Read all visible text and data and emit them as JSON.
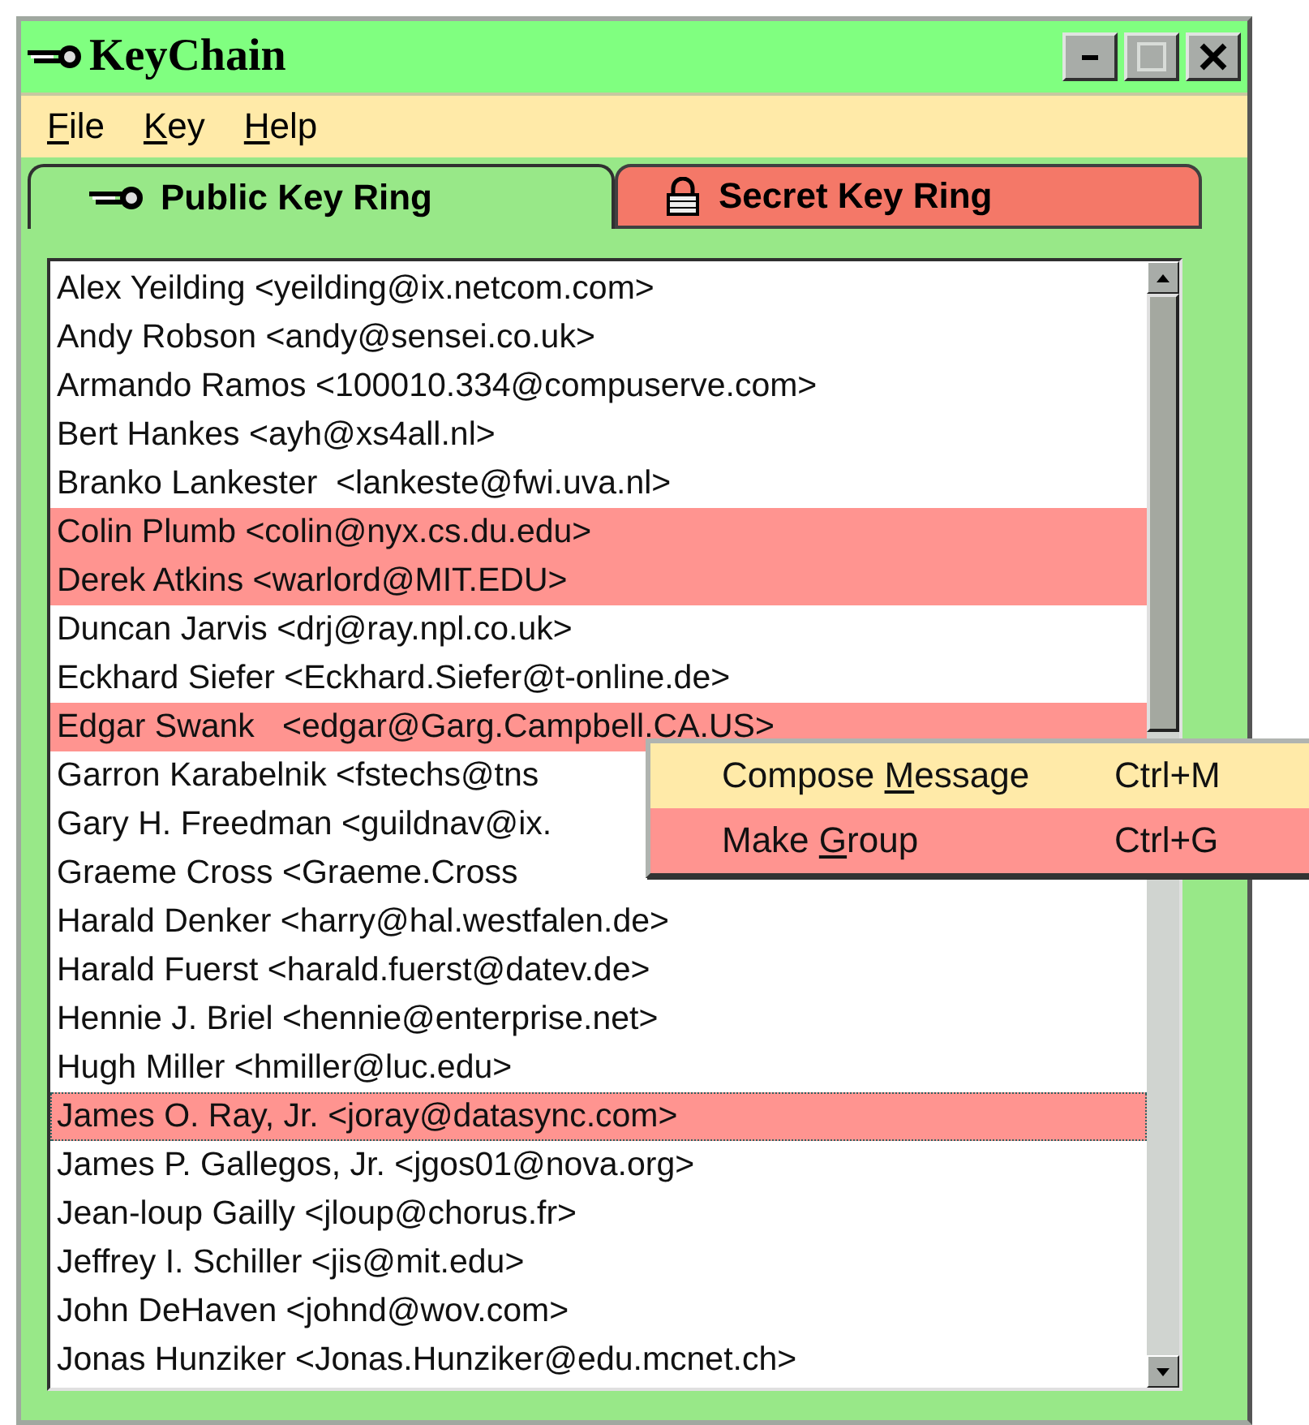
{
  "window": {
    "title": "KeyChain"
  },
  "menu_bar": [
    {
      "mnemonic": "F",
      "label_rest": "ile"
    },
    {
      "mnemonic": "K",
      "label_rest": "ey"
    },
    {
      "mnemonic": "H",
      "label_rest": "elp"
    }
  ],
  "tabs": [
    {
      "label": "Public Key Ring",
      "kind": "key",
      "selected": true,
      "color": "#98e888"
    },
    {
      "label": "Secret Key Ring",
      "kind": "lock",
      "selected": false,
      "color": "#f47868"
    }
  ],
  "keys": [
    {
      "text": "Alex Yeilding <yeilding@ix.netcom.com>",
      "selected": false,
      "focused": false
    },
    {
      "text": "Andy Robson <andy@sensei.co.uk>",
      "selected": false,
      "focused": false
    },
    {
      "text": "Armando Ramos <100010.334@compuserve.com>",
      "selected": false,
      "focused": false
    },
    {
      "text": "Bert Hankes <ayh@xs4all.nl>",
      "selected": false,
      "focused": false
    },
    {
      "text": "Branko Lankester  <lankeste@fwi.uva.nl>",
      "selected": false,
      "focused": false
    },
    {
      "text": "Colin Plumb <colin@nyx.cs.du.edu>",
      "selected": true,
      "focused": false
    },
    {
      "text": "Derek Atkins <warlord@MIT.EDU>",
      "selected": true,
      "focused": false
    },
    {
      "text": "Duncan Jarvis <drj@ray.npl.co.uk>",
      "selected": false,
      "focused": false
    },
    {
      "text": "Eckhard Siefer <Eckhard.Siefer@t-online.de>",
      "selected": false,
      "focused": false
    },
    {
      "text": "Edgar Swank   <edgar@Garg.Campbell.CA.US>",
      "selected": true,
      "focused": false
    },
    {
      "text": "Garron Karabelnik <fstechs@tns",
      "selected": false,
      "focused": false
    },
    {
      "text": "Gary H. Freedman <guildnav@ix.",
      "selected": false,
      "focused": false
    },
    {
      "text": "Graeme Cross <Graeme.Cross",
      "selected": false,
      "focused": false
    },
    {
      "text": "Harald Denker <harry@hal.westfalen.de>",
      "selected": false,
      "focused": false
    },
    {
      "text": "Harald Fuerst <harald.fuerst@datev.de>",
      "selected": false,
      "focused": false
    },
    {
      "text": "Hennie J. Briel <hennie@enterprise.net>",
      "selected": false,
      "focused": false
    },
    {
      "text": "Hugh Miller <hmiller@luc.edu>",
      "selected": false,
      "focused": false
    },
    {
      "text": "James O. Ray, Jr. <joray@datasync.com>",
      "selected": true,
      "focused": true
    },
    {
      "text": "James P. Gallegos, Jr. <jgos01@nova.org>",
      "selected": false,
      "focused": false
    },
    {
      "text": "Jean-loup Gailly <jloup@chorus.fr>",
      "selected": false,
      "focused": false
    },
    {
      "text": "Jeffrey I. Schiller <jis@mit.edu>",
      "selected": false,
      "focused": false
    },
    {
      "text": "John DeHaven <johnd@wov.com>",
      "selected": false,
      "focused": false
    },
    {
      "text": "Jonas Hunziker <Jonas.Hunziker@edu.mcnet.ch>",
      "selected": false,
      "focused": false
    }
  ],
  "context_menu": [
    {
      "label_start": "Compose ",
      "mnemonic": "M",
      "label_rest": "essage",
      "shortcut": "Ctrl+M",
      "selected": false
    },
    {
      "label_start": "Make ",
      "mnemonic": "G",
      "label_rest": "roup",
      "shortcut": "Ctrl+G",
      "selected": true
    }
  ]
}
